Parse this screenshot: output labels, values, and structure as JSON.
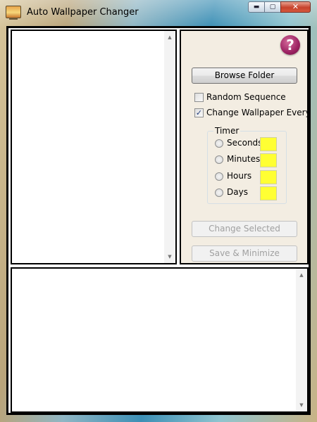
{
  "window": {
    "title": "Auto Wallpaper Changer",
    "icons": {
      "app": "wallpaper-app-icon",
      "minimize": "minimize-icon",
      "maximize": "maximize-icon",
      "close": "close-icon"
    },
    "caption": {
      "minimize": "▬",
      "maximize": "▢",
      "close": "✕"
    }
  },
  "controls": {
    "help_glyph": "?",
    "browse_folder_label": "Browse Folder",
    "random_sequence_label": "Random Sequence",
    "random_sequence_checked": false,
    "change_every_label": "Change Wallpaper Every",
    "change_every_checked": true,
    "check_mark": "✓",
    "timer": {
      "legend": "Timer",
      "options": [
        {
          "label": "Seconds"
        },
        {
          "label": "Minutes"
        },
        {
          "label": "Hours"
        },
        {
          "label": "Days"
        }
      ]
    },
    "change_selected_label": "Change Selected",
    "save_minimize_label": "Save & Minimize"
  },
  "colors": {
    "timer_input_bg": "#ffff33",
    "help_icon": "#9c2262",
    "panel_bg": "#f3ede2"
  },
  "scrollbar": {
    "up": "▲",
    "down": "▼"
  }
}
